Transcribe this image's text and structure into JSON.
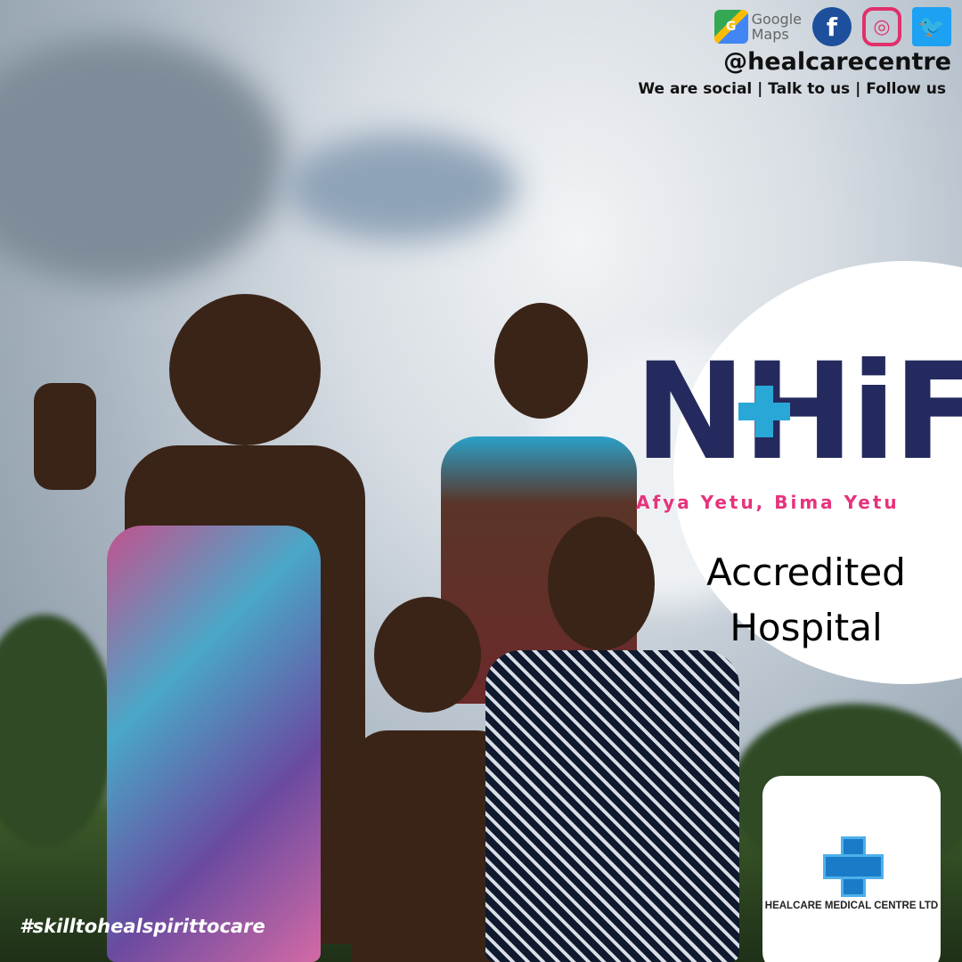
{
  "social": {
    "icons": [
      "google-maps-icon",
      "facebook-icon",
      "instagram-icon",
      "twitter-icon"
    ],
    "maps_label_1": "Google",
    "maps_label_2": "Maps",
    "handle": "@healcarecentre",
    "tagline": "We are social | Talk to us | Follow us"
  },
  "nhif": {
    "logo_text": "NHiF",
    "slogan": "Afya Yetu, Bima Yetu",
    "accredited_line1": "Accredited",
    "accredited_line2": "Hospital"
  },
  "clinic": {
    "name": "HEALCARE MEDICAL CENTRE LTD"
  },
  "hashtag": "#skilltohealspirittocare",
  "colors": {
    "nhif_navy": "#242a5e",
    "nhif_blue": "#29a8d8",
    "slogan_pink": "#e6337c",
    "facebook": "#1e4f9c",
    "twitter": "#1da1f2"
  }
}
